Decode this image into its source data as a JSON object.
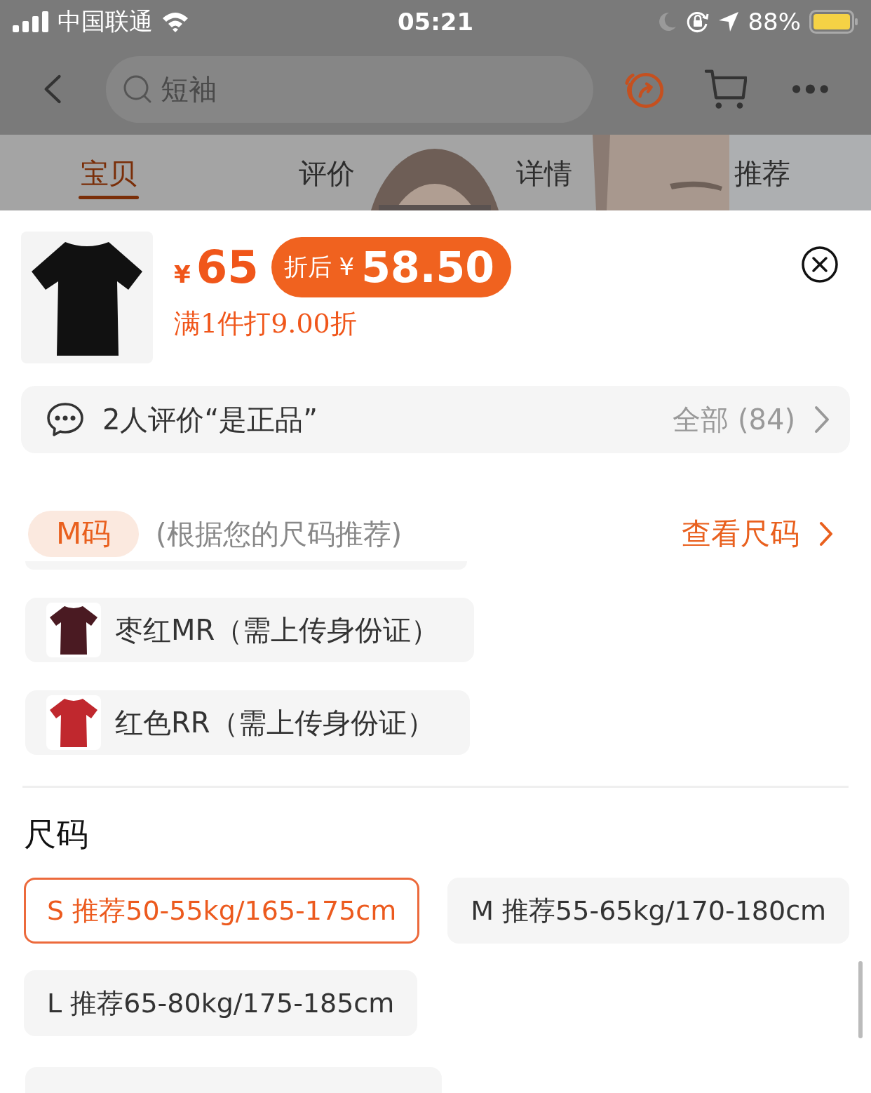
{
  "status_bar": {
    "carrier": "中国联通",
    "time": "05:21",
    "battery": "88%"
  },
  "search": {
    "placeholder": "短袖"
  },
  "tabs": [
    {
      "label": "宝贝",
      "selected": true
    },
    {
      "label": "评价",
      "selected": false
    },
    {
      "label": "详情",
      "selected": false
    },
    {
      "label": "推荐",
      "selected": false
    }
  ],
  "product": {
    "currency": "¥",
    "price": "65",
    "discount": {
      "label": "折后",
      "currency": "¥",
      "price": "58.50"
    },
    "promo": "满1件打9.00折"
  },
  "reviews": {
    "summary": "2人评价“是正品”",
    "all": "全部 (84)"
  },
  "size_hint": {
    "badge": "M码",
    "note": "(根据您的尺码推荐)",
    "link": "查看尺码"
  },
  "colors": [
    {
      "label": "枣红MR（需上传身份证）",
      "color": "#4a1a22"
    },
    {
      "label": "红色RR（需上传身份证）",
      "color": "#c0282e"
    }
  ],
  "size_section": {
    "title": "尺码",
    "options": [
      {
        "label": "S 推荐50-55kg/165-175cm",
        "selected": true
      },
      {
        "label": "M 推荐55-65kg/170-180cm",
        "selected": false
      },
      {
        "label": "L 推荐65-80kg/175-185cm",
        "selected": false
      }
    ]
  }
}
